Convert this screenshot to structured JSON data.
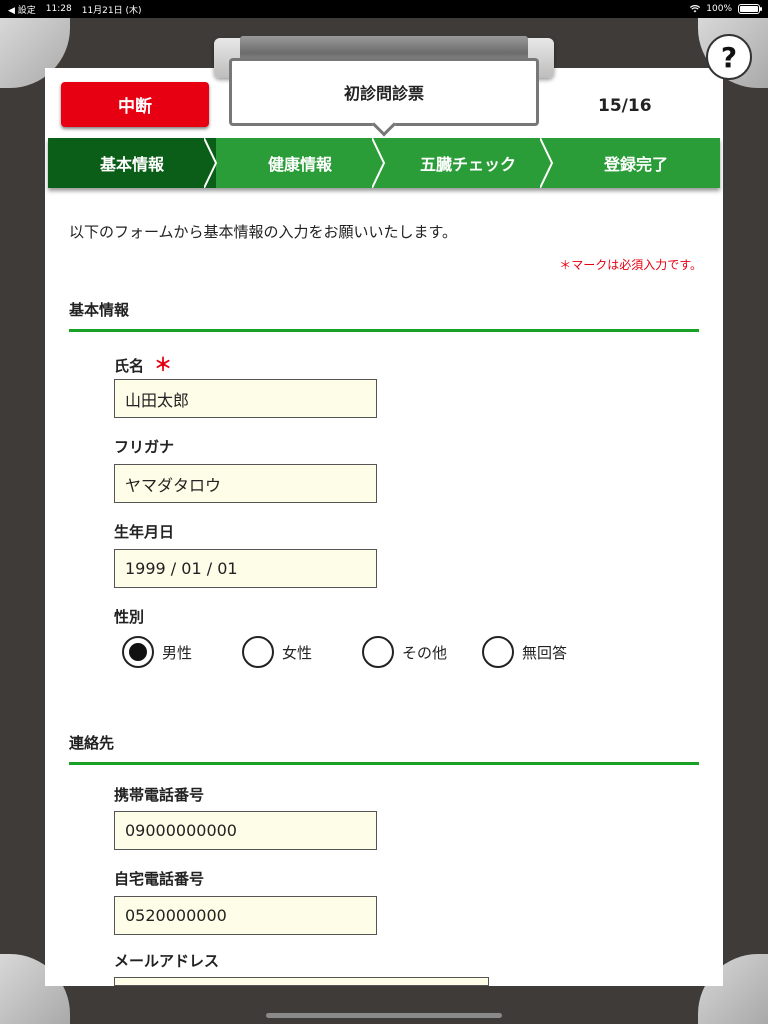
{
  "status_bar": {
    "back_label": "◀ 設定",
    "time": "11:28",
    "date": "11月21日 (木)",
    "battery": "100%"
  },
  "header": {
    "title": "初診問診票",
    "suspend_label": "中断",
    "page_count": "15/16",
    "help_label": "?"
  },
  "steps": [
    "基本情報",
    "健康情報",
    "五臓チェック",
    "登録完了"
  ],
  "intro": "以下のフォームから基本情報の入力をお願いいたします。",
  "required_note": "＊マークは必須入力です。",
  "required_mark": "＊",
  "basic": {
    "section_title": "基本情報",
    "name_label": "氏名",
    "name_value": "山田太郎",
    "furigana_label": "フリガナ",
    "furigana_value": "ヤマダタロウ",
    "dob_label": "生年月日",
    "dob_value": "1999 / 01 / 01",
    "gender_label": "性別",
    "gender_options": [
      "男性",
      "女性",
      "その他",
      "無回答"
    ],
    "gender_selected": "男性"
  },
  "contact": {
    "section_title": "連絡先",
    "mobile_label": "携帯電話番号",
    "mobile_value": "09000000000",
    "home_label": "自宅電話番号",
    "home_value": "0520000000",
    "email_label": "メールアドレス",
    "email_value": ""
  },
  "colors": {
    "accent_green": "#2a9d38",
    "active_green": "#0b5e17",
    "danger_red": "#e60012",
    "field_bg": "#fefde8"
  }
}
